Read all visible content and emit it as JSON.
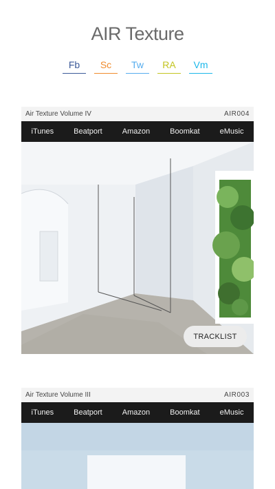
{
  "site": {
    "title": "AIR Texture"
  },
  "social": [
    {
      "label": "Fb",
      "color": "#3b5998"
    },
    {
      "label": "Sc",
      "color": "#f08a2c"
    },
    {
      "label": "Tw",
      "color": "#55acee"
    },
    {
      "label": "RA",
      "color": "#c3c41f"
    },
    {
      "label": "Vm",
      "color": "#1ab7ea"
    }
  ],
  "releases": [
    {
      "name": "Air Texture Volume IV",
      "catalog": "AIR004",
      "stores": [
        "iTunes",
        "Beatport",
        "Amazon",
        "Boomkat",
        "eMusic"
      ],
      "tracklist_label": "TRACKLIST"
    },
    {
      "name": "Air Texture Volume III",
      "catalog": "AIR003",
      "stores": [
        "iTunes",
        "Beatport",
        "Amazon",
        "Boomkat",
        "eMusic"
      ]
    }
  ]
}
